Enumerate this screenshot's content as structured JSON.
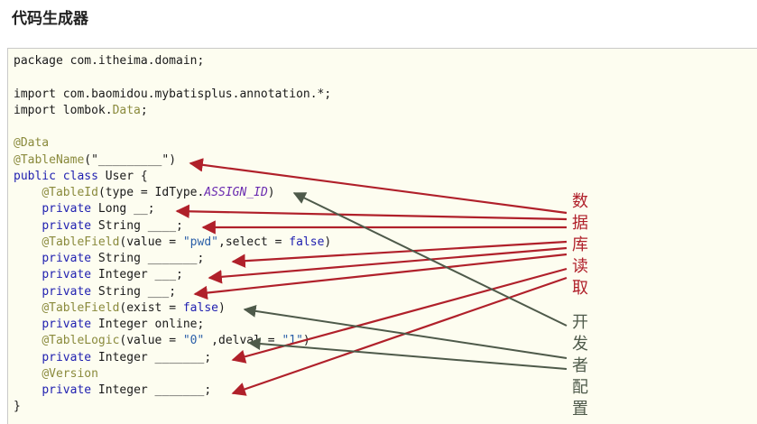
{
  "page": {
    "title": "代码生成器"
  },
  "code": {
    "lines": [
      [
        {
          "t": "package com.itheima.domain;",
          "c": ""
        }
      ],
      [
        {
          "t": "",
          "c": ""
        }
      ],
      [
        {
          "t": "import com.baomidou.mybatisplus.annotation.*;",
          "c": ""
        }
      ],
      [
        {
          "t": "import lombok.",
          "c": ""
        },
        {
          "t": "Data",
          "c": "ann"
        },
        {
          "t": ";",
          "c": ""
        }
      ],
      [
        {
          "t": "",
          "c": ""
        }
      ],
      [
        {
          "t": "@Data",
          "c": "ann"
        }
      ],
      [
        {
          "t": "@TableName",
          "c": "ann"
        },
        {
          "t": "(\"_________\")",
          "c": ""
        }
      ],
      [
        {
          "t": "public class",
          "c": "kw"
        },
        {
          "t": " User {",
          "c": ""
        }
      ],
      [
        {
          "t": "    ",
          "c": ""
        },
        {
          "t": "@TableId",
          "c": "ann"
        },
        {
          "t": "(type = IdType.",
          "c": ""
        },
        {
          "t": "ASSIGN_ID",
          "c": "const"
        },
        {
          "t": ")",
          "c": ""
        }
      ],
      [
        {
          "t": "    ",
          "c": ""
        },
        {
          "t": "private",
          "c": "kw"
        },
        {
          "t": " Long __;",
          "c": ""
        }
      ],
      [
        {
          "t": "    ",
          "c": ""
        },
        {
          "t": "private",
          "c": "kw"
        },
        {
          "t": " String ____;",
          "c": ""
        }
      ],
      [
        {
          "t": "    ",
          "c": ""
        },
        {
          "t": "@TableField",
          "c": "ann"
        },
        {
          "t": "(value = ",
          "c": ""
        },
        {
          "t": "\"pwd\"",
          "c": "str"
        },
        {
          "t": ",select = ",
          "c": ""
        },
        {
          "t": "false",
          "c": "kw"
        },
        {
          "t": ")",
          "c": ""
        }
      ],
      [
        {
          "t": "    ",
          "c": ""
        },
        {
          "t": "private",
          "c": "kw"
        },
        {
          "t": " String _______;",
          "c": ""
        }
      ],
      [
        {
          "t": "    ",
          "c": ""
        },
        {
          "t": "private",
          "c": "kw"
        },
        {
          "t": " Integer ___;",
          "c": ""
        }
      ],
      [
        {
          "t": "    ",
          "c": ""
        },
        {
          "t": "private",
          "c": "kw"
        },
        {
          "t": " String ___;",
          "c": ""
        }
      ],
      [
        {
          "t": "    ",
          "c": ""
        },
        {
          "t": "@TableField",
          "c": "ann"
        },
        {
          "t": "(exist = ",
          "c": ""
        },
        {
          "t": "false",
          "c": "kw"
        },
        {
          "t": ")",
          "c": ""
        }
      ],
      [
        {
          "t": "    ",
          "c": ""
        },
        {
          "t": "private",
          "c": "kw"
        },
        {
          "t": " Integer online;",
          "c": ""
        }
      ],
      [
        {
          "t": "    ",
          "c": ""
        },
        {
          "t": "@TableLogic",
          "c": "ann"
        },
        {
          "t": "(value = ",
          "c": ""
        },
        {
          "t": "\"0\"",
          "c": "str"
        },
        {
          "t": " ,delval = ",
          "c": ""
        },
        {
          "t": "\"1\"",
          "c": "str"
        },
        {
          "t": ")",
          "c": ""
        }
      ],
      [
        {
          "t": "    ",
          "c": ""
        },
        {
          "t": "private",
          "c": "kw"
        },
        {
          "t": " Integer _______;",
          "c": ""
        }
      ],
      [
        {
          "t": "    ",
          "c": ""
        },
        {
          "t": "@Version",
          "c": "ann"
        }
      ],
      [
        {
          "t": "    ",
          "c": ""
        },
        {
          "t": "private",
          "c": "kw"
        },
        {
          "t": " Integer _______;",
          "c": ""
        }
      ],
      [
        {
          "t": "}",
          "c": ""
        }
      ]
    ]
  },
  "labels": {
    "database_read": [
      "数",
      "据",
      "库",
      "读",
      "取"
    ],
    "developer_config": [
      "开",
      "发",
      "者",
      "配",
      "置"
    ]
  },
  "colors": {
    "database_read": "#b0202a",
    "developer_config": "#4e5a4a"
  }
}
